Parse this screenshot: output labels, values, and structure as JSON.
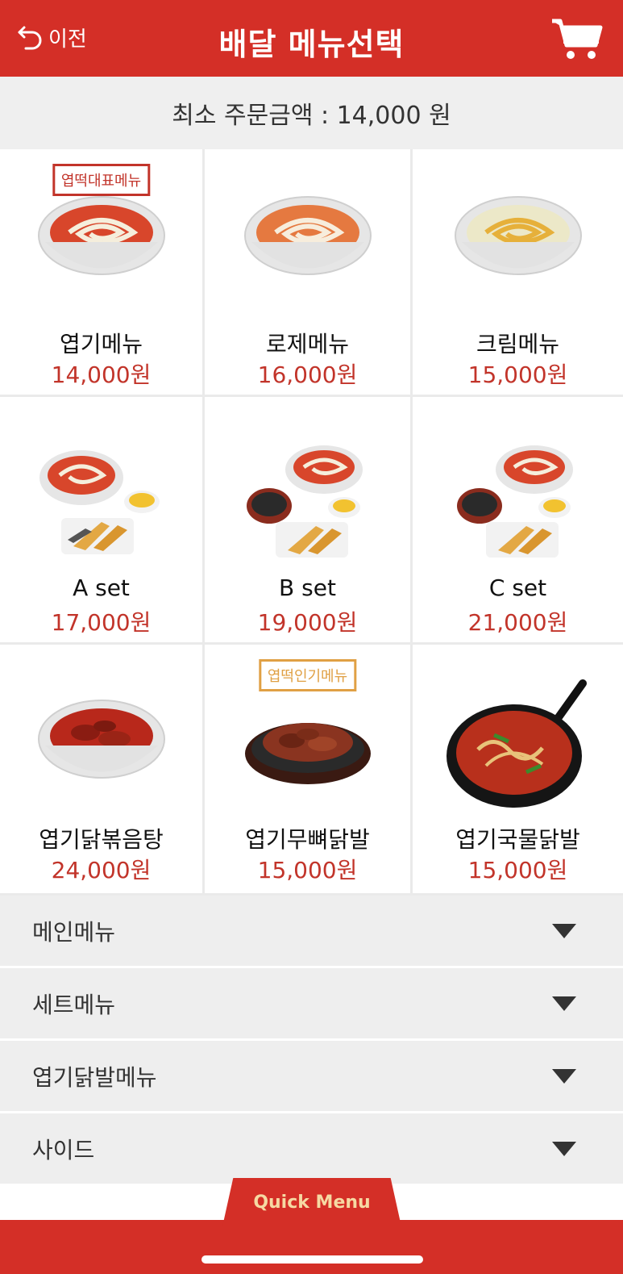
{
  "header": {
    "back_label": "이전",
    "title": "배달 메뉴선택",
    "accent_color": "#d42f27"
  },
  "min_order": "최소 주문금액 : 14,000 원",
  "menu_items": [
    {
      "name": "엽기메뉴",
      "price": "14,000원",
      "badge": "엽떡대표메뉴",
      "badge_color": "red"
    },
    {
      "name": "로제메뉴",
      "price": "16,000원"
    },
    {
      "name": "크림메뉴",
      "price": "15,000원"
    },
    {
      "name": "A set",
      "price": "17,000원"
    },
    {
      "name": "B set",
      "price": "19,000원"
    },
    {
      "name": "C set",
      "price": "21,000원"
    },
    {
      "name": "엽기닭볶음탕",
      "price": "24,000원"
    },
    {
      "name": "엽기무뼈닭발",
      "price": "15,000원",
      "badge": "엽떡인기메뉴",
      "badge_color": "orange"
    },
    {
      "name": "엽기국물닭발",
      "price": "15,000원"
    }
  ],
  "categories": [
    {
      "label": "메인메뉴"
    },
    {
      "label": "세트메뉴"
    },
    {
      "label": "엽기닭발메뉴"
    },
    {
      "label": "사이드"
    }
  ],
  "quick_menu_label": "Quick Menu"
}
